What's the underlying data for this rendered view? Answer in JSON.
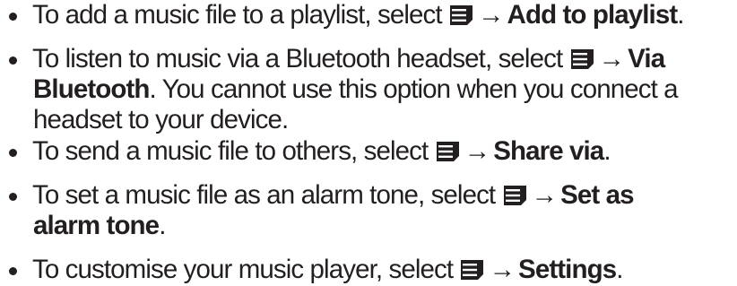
{
  "bullets": [
    {
      "lines": [
        {
          "prefix": "To add a music file to a playlist, select",
          "arrow": "→",
          "bold": "Add to playlist",
          "suffix": "."
        }
      ]
    },
    {
      "lines": [
        {
          "prefix": "To listen to music via a Bluetooth headset, select",
          "arrow": "→",
          "bold": "Via"
        },
        {
          "bold": "Bluetooth",
          "suffix": ". You cannot use this option when you connect a"
        },
        {
          "text": "headset to your device."
        }
      ]
    },
    {
      "lines": [
        {
          "prefix": "To send a music file to others, select",
          "arrow": "→",
          "bold": "Share via",
          "suffix": "."
        }
      ]
    },
    {
      "lines": [
        {
          "prefix": "To set a music file as an alarm tone, select",
          "arrow": "→",
          "bold": "Set as"
        },
        {
          "bold": "alarm tone",
          "suffix": "."
        }
      ]
    },
    {
      "lines": [
        {
          "prefix": "To customise your music player, select",
          "arrow": "→",
          "bold": "Settings",
          "suffix": "."
        }
      ]
    }
  ],
  "icons": {
    "menu_icon": "menu-icon",
    "icon_color": "#231f20"
  }
}
